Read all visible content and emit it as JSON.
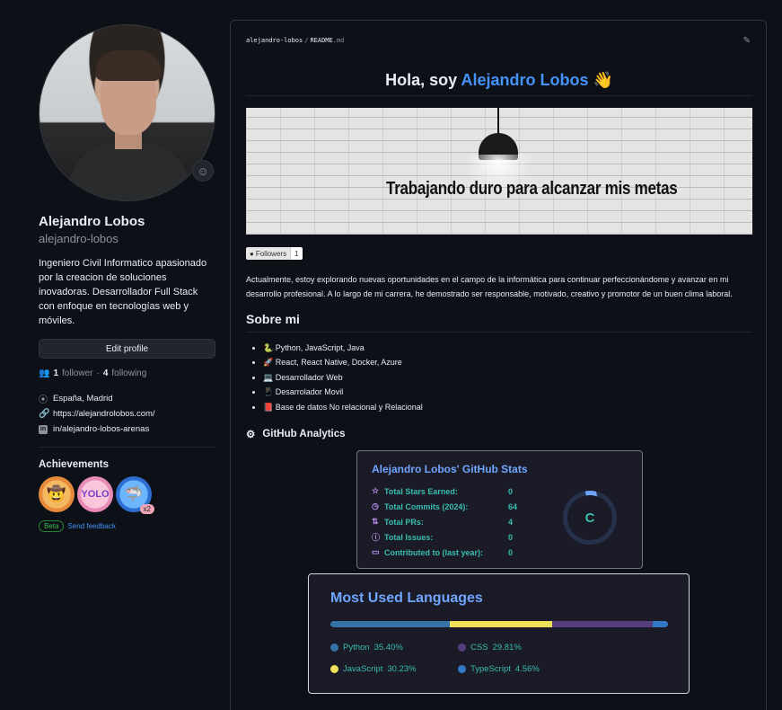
{
  "profile": {
    "name": "Alejandro Lobos",
    "username": "alejandro-lobos",
    "bio": "Ingeniero Civil Informatico apasionado por la creacion de soluciones inovadoras. Desarrollador Full Stack con enfoque en tecnologías web y móviles.",
    "edit_label": "Edit profile",
    "followers_count": "1",
    "followers_label": "follower",
    "following_count": "4",
    "following_label": "following",
    "location": "España, Madrid",
    "website": "https://alejandrolobos.com/",
    "linkedin": "in/alejandro-lobos-arenas",
    "linkedin_icon": "in",
    "status_icon": "☺"
  },
  "achievements": {
    "title": "Achievements",
    "badge1": "🤠",
    "badge2": "YOLO",
    "badge3": "🦈",
    "badge3_count": "x2",
    "beta_label": "Beta",
    "feedback_label": "Send feedback"
  },
  "readme": {
    "path_user": "alejandro-lobos",
    "path_sep": "/",
    "path_file": "README",
    "path_ext": ".md",
    "title_prefix": "Hola, soy ",
    "title_name": "Alejandro Lobos",
    "title_emoji": "👋",
    "banner_text": "Trabajando duro para alcanzar mis metas",
    "followers_badge_label": "Followers",
    "followers_badge_count": "1",
    "paragraph": "Actualmente, estoy explorando nuevas oportunidades en el campo de la informática para continuar perfeccionándome y avanzar en mi desarrollo profesional. A lo largo de mi carrera, he demostrado ser responsable, motivado, creativo y promotor de un buen clima laboral.",
    "about_title": "Sobre mi",
    "about_items": [
      "🐍 Python, JavaScript, Java",
      "🚀 React, React Native, Docker, Azure",
      "💻 Desarrollador Web",
      "📱 Desarrolador Movil",
      "📕 Base de datos No relacional y Relacional"
    ],
    "analytics_title": "GitHub Analytics",
    "analytics_icon": "⚙"
  },
  "stats": {
    "title": "Alejandro Lobos' GitHub Stats",
    "rows": [
      {
        "icon": "☆",
        "label": "Total Stars Earned:",
        "value": "0"
      },
      {
        "icon": "◷",
        "label": "Total Commits (2024):",
        "value": "64"
      },
      {
        "icon": "⇅",
        "label": "Total PRs:",
        "value": "4"
      },
      {
        "icon": "ⓘ",
        "label": "Total Issues:",
        "value": "0"
      },
      {
        "icon": "▭",
        "label": "Contributed to (last year):",
        "value": "0"
      }
    ],
    "grade": "C"
  },
  "languages": {
    "title": "Most Used Languages",
    "items": [
      {
        "name": "Python",
        "percent": "35.40%",
        "value": 35.4,
        "color": "#3572A5"
      },
      {
        "name": "CSS",
        "percent": "29.81%",
        "value": 29.81,
        "color": "#563d7c"
      },
      {
        "name": "JavaScript",
        "percent": "30.23%",
        "value": 30.23,
        "color": "#f1e05a"
      },
      {
        "name": "TypeScript",
        "percent": "4.56%",
        "value": 4.56,
        "color": "#3178c6"
      }
    ],
    "bar_order": [
      0,
      2,
      1,
      3
    ]
  }
}
